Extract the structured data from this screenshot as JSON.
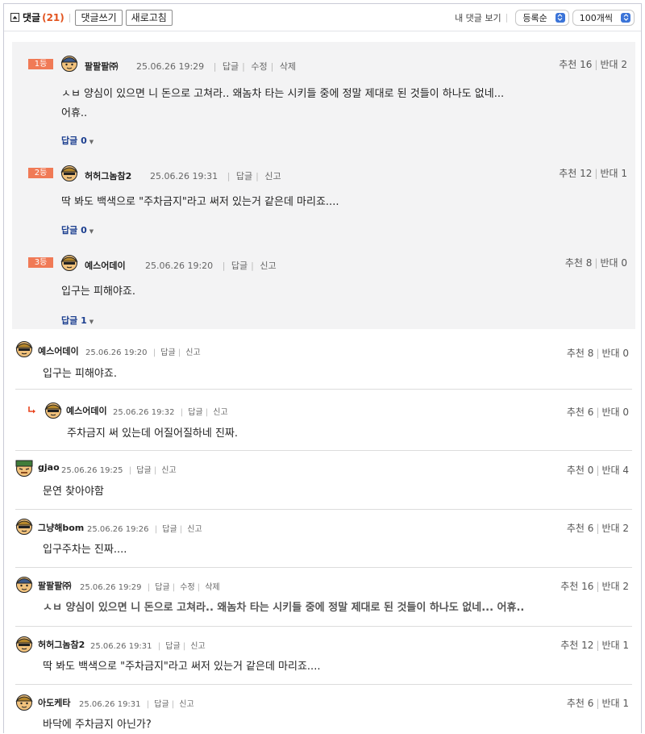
{
  "header": {
    "title": "댓글",
    "count": "(21)",
    "write_button": "댓글쓰기",
    "refresh_button": "새로고침",
    "my_comments": "내 댓글 보기",
    "sort_select": "등록순",
    "per_page_select": "100개씩"
  },
  "best": [
    {
      "rank": "1등",
      "author": "팔팔팔㈜",
      "time": "25.06.26 19:29",
      "actions": [
        "답글",
        "수정",
        "삭제"
      ],
      "up": "추천 16",
      "down": "반대 2",
      "text": "ㅅㅂ 양심이 있으면 니 돈으로 고쳐라.. 왜놈차 타는 시키들 중에 정말 제대로 된 것들이 하나도 없네... 어휴..",
      "replies": "답글 0"
    },
    {
      "rank": "2등",
      "author": "허허그놈참2",
      "time": "25.06.26 19:31",
      "actions": [
        "답글",
        "신고"
      ],
      "up": "추천 12",
      "down": "반대 1",
      "text": "딱 봐도 백색으로 \"주차금지\"라고 써저 있는거 같은데 마리죠....",
      "replies": "답글 0"
    },
    {
      "rank": "3등",
      "author": "예스어데이",
      "time": "25.06.26 19:20",
      "actions": [
        "답글",
        "신고"
      ],
      "up": "추천 8",
      "down": "반대 0",
      "text": "입구는 피해야죠.",
      "replies": "답글 1"
    }
  ],
  "comments": [
    {
      "author": "예스어데이",
      "time": "25.06.26 19:20",
      "actions": [
        "답글",
        "신고"
      ],
      "up": "추천 8",
      "down": "반대 0",
      "text": "입구는 피해야죠."
    },
    {
      "author": "예스어데이",
      "time": "25.06.26 19:32",
      "actions": [
        "답글",
        "신고"
      ],
      "up": "추천 6",
      "down": "반대 0",
      "text": "주차금지 써 있는데 어질어질하네 진짜."
    },
    {
      "author": "gjao",
      "time": "25.06.26 19:25",
      "actions": [
        "답글",
        "신고"
      ],
      "up": "추천 0",
      "down": "반대 4",
      "text": "문연 찾아야함"
    },
    {
      "author": "그냥해bom",
      "time": "25.06.26 19:26",
      "actions": [
        "답글",
        "신고"
      ],
      "up": "추천 6",
      "down": "반대 2",
      "text": "입구주차는 진짜...."
    },
    {
      "author": "팔팔팔㈜",
      "time": "25.06.26 19:29",
      "actions": [
        "답글",
        "수정",
        "삭제"
      ],
      "up": "추천 16",
      "down": "반대 2",
      "text": "ㅅㅂ 양심이 있으면 니 돈으로 고쳐라.. 왜놈차 타는 시키들 중에 정말 제대로 된 것들이 하나도 없네... 어휴.."
    },
    {
      "author": "허허그놈참2",
      "time": "25.06.26 19:31",
      "actions": [
        "답글",
        "신고"
      ],
      "up": "추천 12",
      "down": "반대 1",
      "text": "딱 봐도 백색으로 \"주차금지\"라고 써저 있는거 같은데 마리죠...."
    },
    {
      "author": "아도케타",
      "time": "25.06.26 19:31",
      "actions": [
        "답글",
        "신고"
      ],
      "up": "추천 6",
      "down": "반대 1",
      "text": "바닥에 주차금지 아닌가?"
    }
  ],
  "colors": {
    "accent": "#e2541f",
    "rank_bg": "#f07a56",
    "reply_link": "#1b3e8f",
    "select_arrow": "#3b74d8"
  }
}
